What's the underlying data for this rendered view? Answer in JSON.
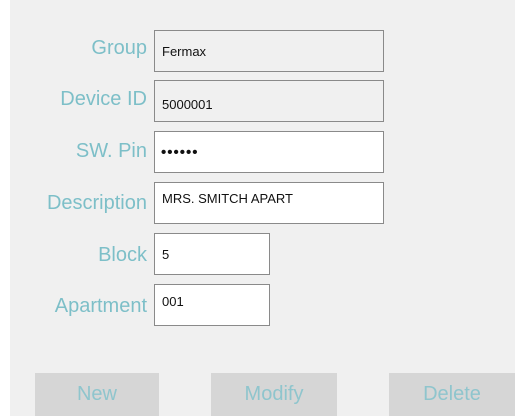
{
  "form": {
    "group": {
      "label": "Group",
      "value": "Fermax"
    },
    "device_id": {
      "label": "Device ID",
      "value": "5000001"
    },
    "sw_pin": {
      "label": "SW. Pin",
      "value": "••••••"
    },
    "description": {
      "label": "Description",
      "value": "MRS. SMITCH APART"
    },
    "block": {
      "label": "Block",
      "value": "5"
    },
    "apartment": {
      "label": "Apartment",
      "value": "001"
    }
  },
  "buttons": {
    "new": "New",
    "modify": "Modify",
    "delete": "Delete"
  },
  "colors": {
    "label": "#7dbfc8",
    "button_text": "#8fc5cd",
    "button_bg": "#d6d6d6",
    "panel_bg": "#f0f0f0"
  }
}
